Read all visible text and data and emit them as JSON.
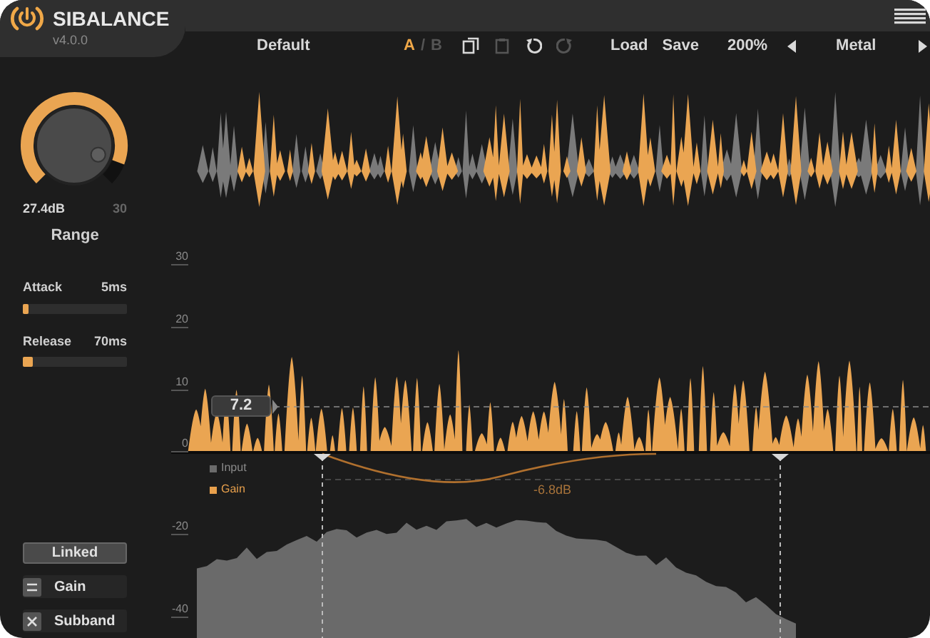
{
  "app": {
    "name": "SIBALANCE",
    "version": "v4.0.0"
  },
  "toolbar": {
    "preset": "Default",
    "ab": [
      {
        "label": "A",
        "selected": true
      },
      {
        "label": "B",
        "selected": false
      }
    ],
    "ab_separator": "/",
    "actions": [
      {
        "kind": "copy",
        "disabled": false
      },
      {
        "kind": "paste",
        "disabled": true
      },
      {
        "kind": "undo",
        "disabled": false
      },
      {
        "kind": "redo",
        "disabled": true
      }
    ],
    "load": "Load",
    "save": "Save",
    "zoom": "200%",
    "theme": "Metal"
  },
  "range_knob": {
    "value": "27.4dB",
    "max": "30",
    "label": "Range",
    "level": 0.91
  },
  "sliders": [
    {
      "label": "Attack",
      "reading": "5ms",
      "level": 0.06
    },
    {
      "label": "Release",
      "reading": "70ms",
      "level": 0.1
    }
  ],
  "linked_button": "Linked",
  "options": [
    {
      "label": "Gain",
      "kind": "lines"
    },
    {
      "label": "Subband",
      "kind": "cross"
    }
  ],
  "graph": {
    "axis_labels": [
      "30",
      "20",
      "10",
      "0",
      "-20",
      "-40"
    ],
    "legend": [
      {
        "label": "Input",
        "color": "#6b6b6b"
      },
      {
        "label": "Gain",
        "color": "#e8a04c"
      }
    ],
    "threshold": "7.2",
    "band_gain": "-6.8dB"
  }
}
